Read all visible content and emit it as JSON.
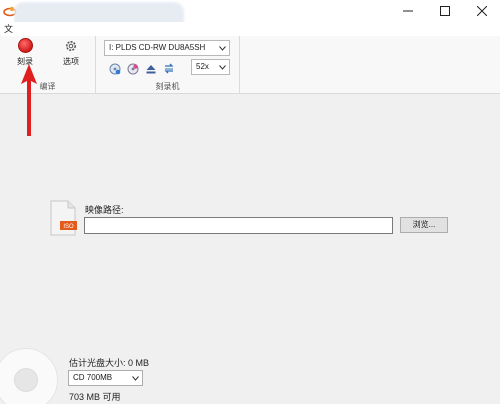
{
  "titlebar": {
    "minimize_glyph": "—",
    "maximize_glyph": "☐",
    "close_glyph": "✕"
  },
  "menu": {
    "file_label": "文"
  },
  "ribbon": {
    "burn_label": "刻录",
    "options_label": "选项",
    "edit_group_label": "编译",
    "device_value": "I: PLDS  CD-RW DU8A5SH",
    "speed_value": "52x",
    "burner_group_label": "刻录机"
  },
  "main": {
    "iso_badge": "ISO",
    "image_path_label": "映像路径:",
    "image_path_value": "",
    "browse_label": "浏览..."
  },
  "footer": {
    "estimated_size": "估计光盘大小: 0 MB",
    "disc_type": "CD 700MB",
    "available": "703 MB 可用"
  },
  "colors": {
    "accent_red": "#d21c1c",
    "arrow_red": "#e02020"
  }
}
